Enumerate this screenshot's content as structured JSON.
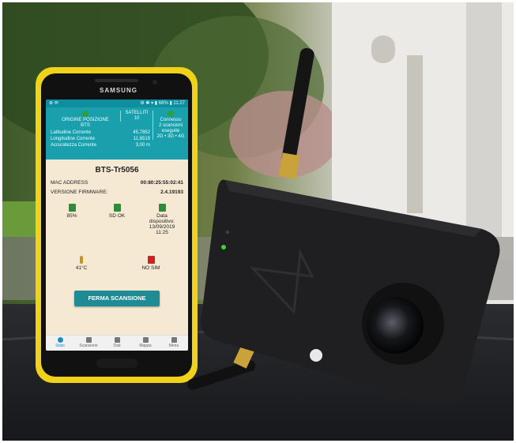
{
  "phone": {
    "brand": "SAMSUNG"
  },
  "status_bar": {
    "left": "⊕ ✉",
    "right": "⚙ ✱ ▾ ▮ 68% ▮ 11:27"
  },
  "header": {
    "origin_label": "ORIGINE POSIZIONE",
    "origin_value": "BTS",
    "satellites_label": "SATELLITI",
    "satellites_value": "10",
    "connection_label": "Connesso",
    "scans_line1": "2 scansioni",
    "scans_line2": "eseguite",
    "scans_bands": "2G • 3G • 4G",
    "rows": [
      {
        "label": "Latitudine Corrente",
        "value": "45,7852"
      },
      {
        "label": "Longitudine Corrente",
        "value": "11,6519"
      },
      {
        "label": "Accuratezza Corrente",
        "value": "3,00 m"
      }
    ]
  },
  "device": {
    "name": "BTS-Tr5056",
    "mac_label": "MAC ADDRESS",
    "mac_value": "00:80:25:55:02:41",
    "fw_label": "VERSIONE FIRMWARE:",
    "fw_value": "2.4.19193"
  },
  "tiles": {
    "battery": "85%",
    "sd": "SD OK",
    "date_label": "Data",
    "date_label2": "dispositivo:",
    "date_value": "13/09/2019",
    "time_value": "11:25",
    "temp": "41°C",
    "sim": "NO SIM"
  },
  "action": {
    "stop_scan": "FERMA SCANSIONE"
  },
  "nav": [
    {
      "label": "Stato"
    },
    {
      "label": "Scansione"
    },
    {
      "label": "Dati"
    },
    {
      "label": "Mappa"
    },
    {
      "label": "Menu"
    }
  ],
  "colors": {
    "app_header": "#1aa0ad",
    "button": "#1f8c95",
    "phone_case": "#f0d21a",
    "device": "#1f1f21"
  }
}
